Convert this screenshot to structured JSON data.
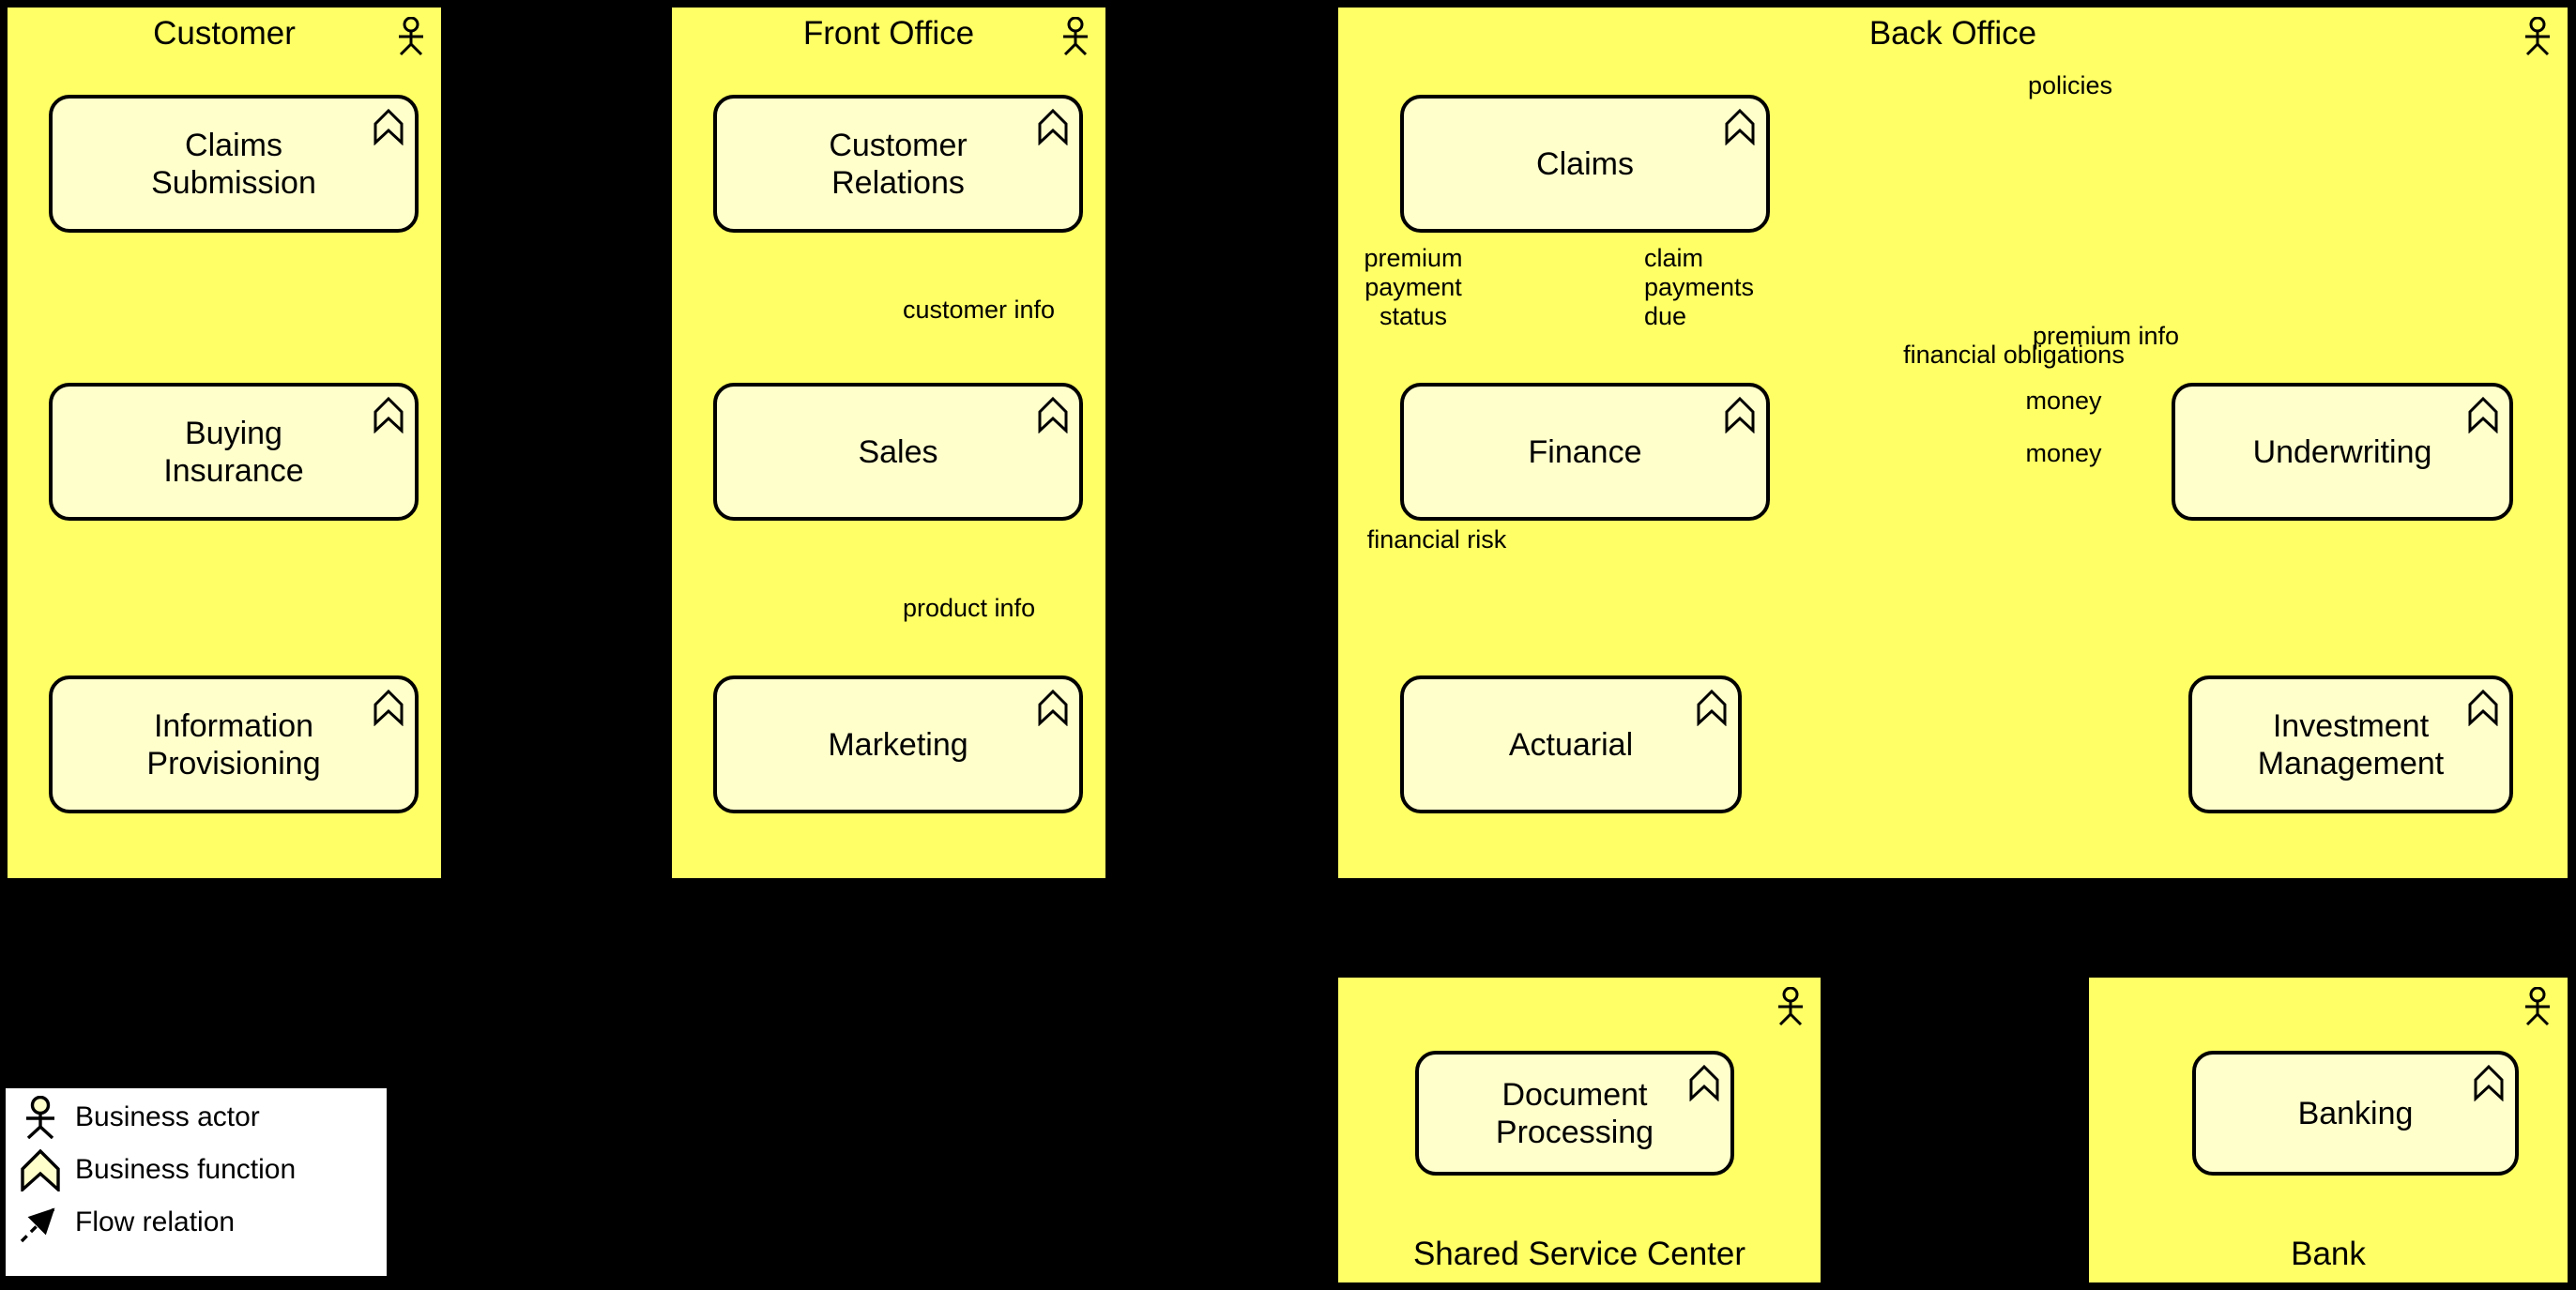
{
  "diagram": {
    "type": "archimate-business-function-cooperation",
    "colors": {
      "background": "#000000",
      "actor_fill": "#FFFF66",
      "function_fill": "#FFFFCC",
      "line": "#000000",
      "legend_fill": "#FFFFFF"
    }
  },
  "actors": [
    {
      "id": "customer",
      "name": "Customer",
      "title_position": "top",
      "icon": "business-actor-icon",
      "functions": [
        {
          "id": "claims-submission",
          "label": "Claims\nSubmission"
        },
        {
          "id": "buying-insurance",
          "label": "Buying\nInsurance"
        },
        {
          "id": "information-provisioning",
          "label": "Information\nProvisioning"
        }
      ]
    },
    {
      "id": "front-office",
      "name": "Front Office",
      "title_position": "top",
      "icon": "business-actor-icon",
      "functions": [
        {
          "id": "customer-relations",
          "label": "Customer\nRelations"
        },
        {
          "id": "sales",
          "label": "Sales"
        },
        {
          "id": "marketing",
          "label": "Marketing"
        }
      ]
    },
    {
      "id": "back-office",
      "name": "Back Office",
      "title_position": "top",
      "icon": "business-actor-icon",
      "functions": [
        {
          "id": "claims",
          "label": "Claims"
        },
        {
          "id": "finance",
          "label": "Finance"
        },
        {
          "id": "underwriting",
          "label": "Underwriting"
        },
        {
          "id": "actuarial",
          "label": "Actuarial"
        },
        {
          "id": "investment-management",
          "label": "Investment\nManagement"
        }
      ]
    },
    {
      "id": "shared-service-center",
      "name": "Shared Service Center",
      "title_position": "bottom",
      "icon": "business-actor-icon",
      "functions": [
        {
          "id": "document-processing",
          "label": "Document\nProcessing"
        }
      ]
    },
    {
      "id": "bank",
      "name": "Bank",
      "title_position": "bottom",
      "icon": "business-actor-icon",
      "functions": [
        {
          "id": "banking",
          "label": "Banking"
        }
      ]
    }
  ],
  "flow_labels": {
    "customer_info": "customer info",
    "product_info": "product info",
    "policies": "policies",
    "premium_payment_status": "premium\npayment\nstatus",
    "claim_payments_due": "claim\npayments\ndue",
    "financial_obligations": "financial obligations",
    "financial_risk": "financial risk",
    "premium_info": "premium info",
    "money_upper": "money",
    "money_lower": "money"
  },
  "legend": {
    "items": [
      {
        "id": "business-actor",
        "icon": "business-actor-icon",
        "label": "Business actor"
      },
      {
        "id": "business-function",
        "icon": "business-function-icon",
        "label": "Business function"
      },
      {
        "id": "flow-relation",
        "icon": "flow-relation-icon",
        "label": "Flow relation"
      }
    ]
  }
}
